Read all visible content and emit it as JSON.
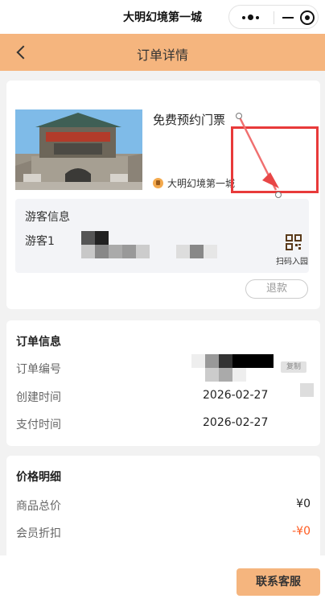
{
  "mp_bar": {
    "title": "大明幻境第一城",
    "capsule_icons": [
      "more-dots-icon",
      "minimize-icon",
      "close-target-icon"
    ]
  },
  "nav": {
    "back_icon": "chevron-left-icon",
    "title": "订单详情",
    "bg_color": "#f5b57e"
  },
  "ticket": {
    "product_name": "免费预约门票",
    "venue": "大明幻境第一城",
    "visitor_section_label": "游客信息",
    "visitor_name": "游客1",
    "scan_label": "扫码入园",
    "scan_icon": "qr-code-icon",
    "refund_label": "退款"
  },
  "order_info": {
    "title": "订单信息",
    "order_no_label": "订单编号",
    "copy_label": "复制",
    "created_label": "创建时间",
    "created_value": "2026-02-27",
    "paid_label": "支付时间",
    "paid_value": "2026-02-27"
  },
  "price": {
    "title": "价格明细",
    "total_label": "商品总价",
    "total_value": "¥0",
    "discount_label": "会员折扣",
    "discount_value": "-¥0",
    "discount_color": "#ff5a1f"
  },
  "bottom": {
    "service_label": "联系客服"
  },
  "annotation_color": "#e83a3a"
}
